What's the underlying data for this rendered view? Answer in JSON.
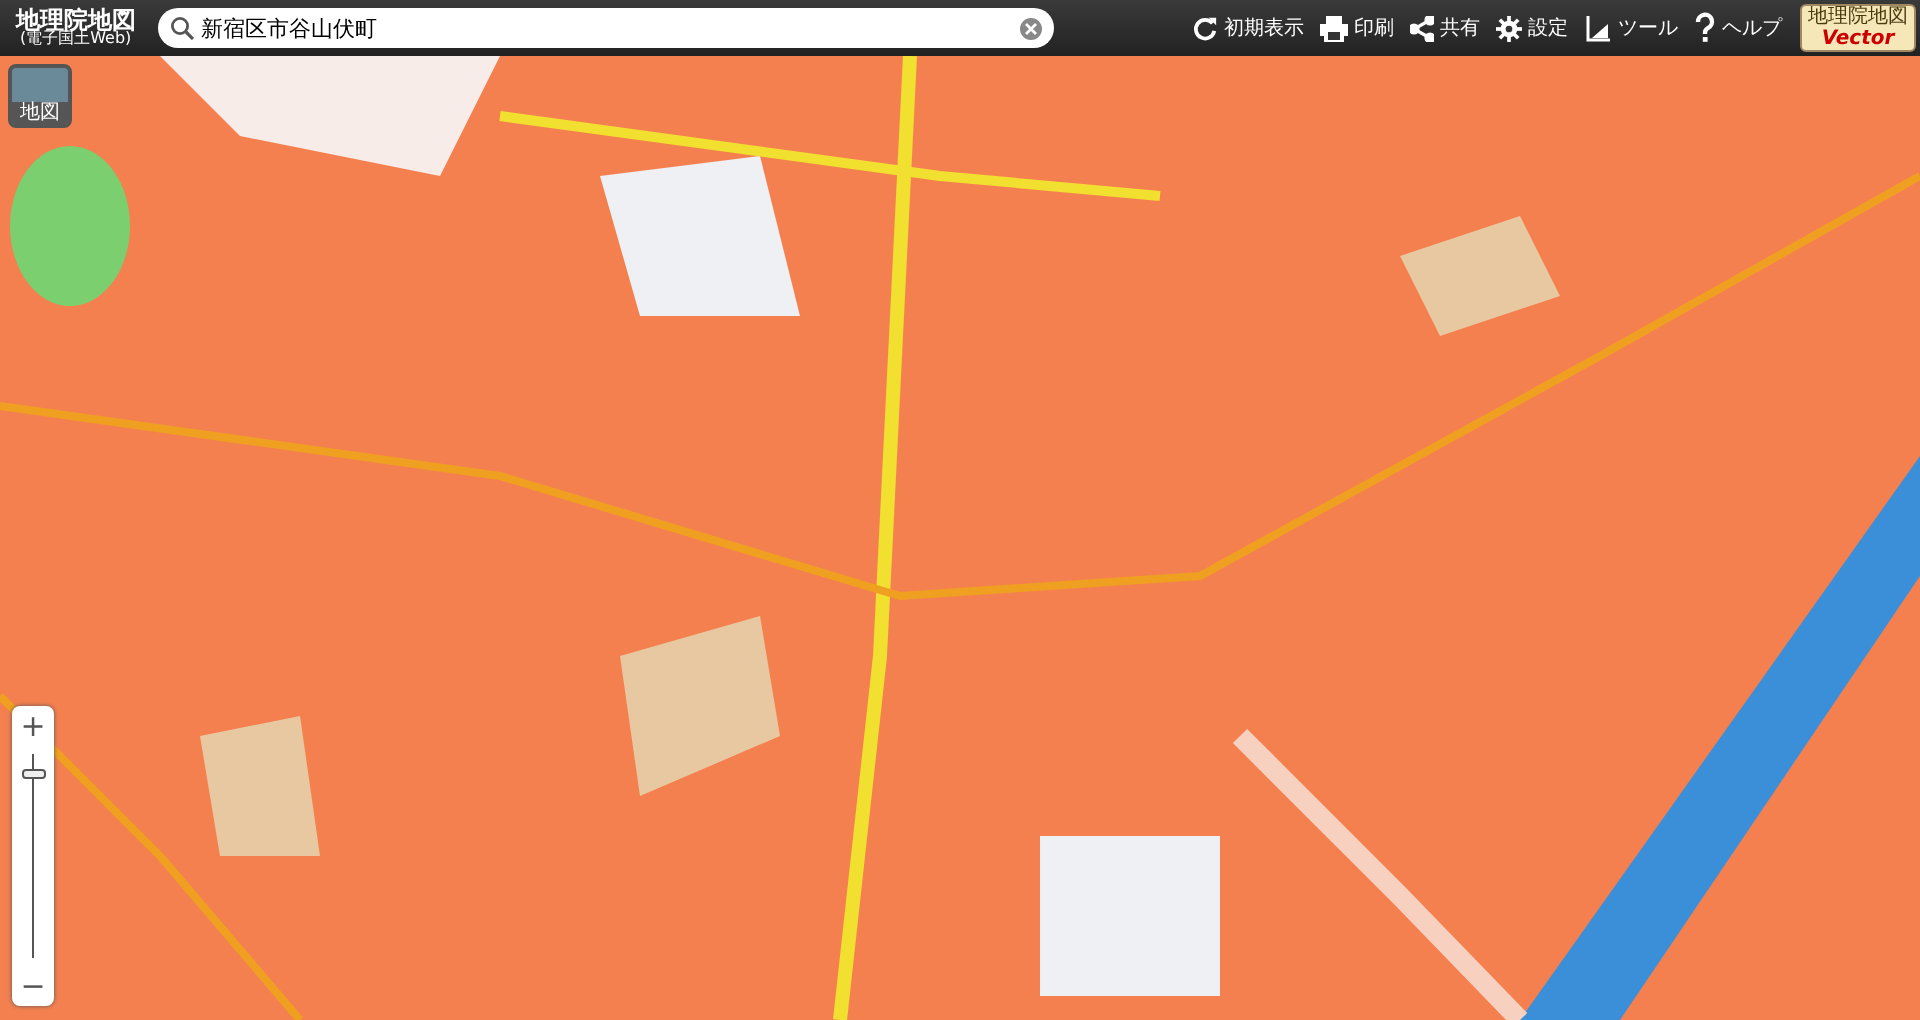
{
  "app": {
    "title": "地理院地図",
    "subtitle": "(電子国土Web)"
  },
  "search": {
    "value": "新宿区市谷山伏町"
  },
  "toolbar": [
    {
      "kind": "reset",
      "label": "初期表示"
    },
    {
      "kind": "print",
      "label": "印刷"
    },
    {
      "kind": "share",
      "label": "共有"
    },
    {
      "kind": "settings",
      "label": "設定"
    },
    {
      "kind": "tools",
      "label": "ツール"
    },
    {
      "kind": "help",
      "label": "ヘルプ"
    }
  ],
  "vector_badge": {
    "top": "地理院地図",
    "bottom": "Vector"
  },
  "layer_button": {
    "label": "地図"
  },
  "zoom": {
    "plus": "+",
    "minus": "−",
    "level": 0.9
  }
}
